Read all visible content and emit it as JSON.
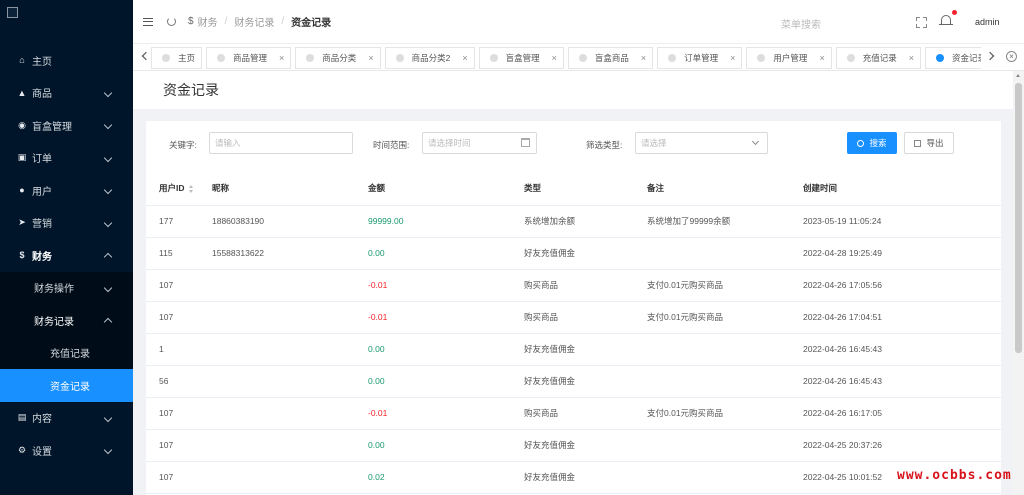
{
  "sidebar": {
    "items": [
      {
        "icon": "home-icon",
        "label": "主页"
      },
      {
        "icon": "shop-icon",
        "label": "商品"
      },
      {
        "icon": "trophy-icon",
        "label": "盲盒管理"
      },
      {
        "icon": "cart-icon",
        "label": "订单"
      },
      {
        "icon": "user-icon",
        "label": "用户"
      },
      {
        "icon": "send-icon",
        "label": "营销"
      },
      {
        "icon": "dollar-icon",
        "label": "财务"
      },
      {
        "label": "财务操作"
      },
      {
        "label": "财务记录"
      },
      {
        "label": "充值记录"
      },
      {
        "label": "资金记录"
      },
      {
        "icon": "book-icon",
        "label": "内容"
      },
      {
        "icon": "gear-icon",
        "label": "设置"
      }
    ]
  },
  "header": {
    "breadcrumb": [
      "财务",
      "财务记录",
      "资金记录"
    ],
    "menu_search": "菜单搜索",
    "user": "admin"
  },
  "tabs": [
    {
      "label": "主页",
      "closable": false
    },
    {
      "label": "商品管理",
      "closable": true
    },
    {
      "label": "商品分类",
      "closable": true
    },
    {
      "label": "商品分类2",
      "closable": true
    },
    {
      "label": "盲盒管理",
      "closable": true
    },
    {
      "label": "盲盒商品",
      "closable": true
    },
    {
      "label": "订单管理",
      "closable": true
    },
    {
      "label": "用户管理",
      "closable": true
    },
    {
      "label": "充值记录",
      "closable": true
    },
    {
      "label": "资金记录",
      "closable": true,
      "active": true
    }
  ],
  "page": {
    "title": "资金记录"
  },
  "filters": {
    "keyword_label": "关键字:",
    "keyword_placeholder": "请输入",
    "range_label": "时间范围:",
    "range_placeholder": "请选择时间",
    "type_label": "筛选类型:",
    "type_placeholder": "请选择",
    "search_button": "搜索",
    "export_button": "导出"
  },
  "table": {
    "columns": [
      "用户ID",
      "昵称",
      "金额",
      "类型",
      "备注",
      "创建时间"
    ],
    "rows": [
      [
        "177",
        "18860383190",
        "99999.00",
        "系统增加余额",
        "系统增加了99999余额",
        "2023-05-19 11:05:24"
      ],
      [
        "115",
        "15588313622",
        "0.00",
        "好友充值佣金",
        "",
        "2022-04-28 19:25:49"
      ],
      [
        "107",
        "",
        "-0.01",
        "购买商品",
        "支付0.01元购买商品",
        "2022-04-26 17:05:56"
      ],
      [
        "107",
        "",
        "-0.01",
        "购买商品",
        "支付0.01元购买商品",
        "2022-04-26 17:04:51"
      ],
      [
        "1",
        "",
        "0.00",
        "好友充值佣金",
        "",
        "2022-04-26 16:45:43"
      ],
      [
        "56",
        "",
        "0.00",
        "好友充值佣金",
        "",
        "2022-04-26 16:45:43"
      ],
      [
        "107",
        "",
        "-0.01",
        "购买商品",
        "支付0.01元购买商品",
        "2022-04-26 16:17:05"
      ],
      [
        "107",
        "",
        "0.00",
        "好友充值佣金",
        "",
        "2022-04-25 20:37:26"
      ],
      [
        "107",
        "",
        "0.02",
        "好友充值佣金",
        "",
        "2022-04-25 10:01:52"
      ]
    ]
  },
  "watermark": "www.ocbbs.com",
  "colors": {
    "accent": "#1890ff",
    "sidebar": "#001529",
    "positive": "#1a9a6c",
    "negative": "#f5222d"
  }
}
